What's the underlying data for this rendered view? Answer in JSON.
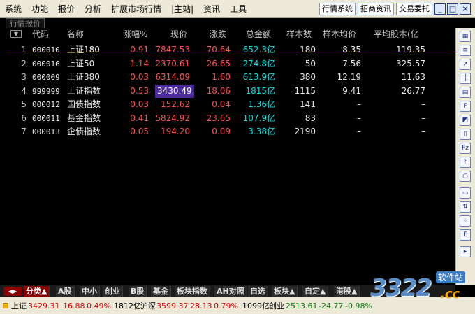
{
  "menubar": {
    "items": [
      "系统",
      "功能",
      "报价",
      "分析",
      "扩展市场行情",
      "|主站|",
      "资讯",
      "工具"
    ],
    "buttons": [
      "行情系统",
      "招商资讯",
      "交易委托"
    ],
    "window_buttons": [
      "_",
      "□",
      "×"
    ]
  },
  "tabstrip": {
    "active_tab": "行情报价"
  },
  "table": {
    "sort_glyph": "▼",
    "columns": [
      "代码",
      "名称",
      "涨幅%",
      "现价",
      "涨跌",
      "总金额",
      "样本数",
      "样本均价",
      "平均股本(亿"
    ],
    "rows": [
      {
        "idx": "1",
        "code": "000010",
        "name": "上证180",
        "pct": "0.91",
        "price": "7847.53",
        "chg": "70.64",
        "amount": "652.3亿",
        "samples": "180",
        "avg_price": "8.35",
        "avg_cap": "119.35"
      },
      {
        "idx": "2",
        "code": "000016",
        "name": "上证50",
        "pct": "1.14",
        "price": "2370.61",
        "chg": "26.65",
        "amount": "274.8亿",
        "samples": "50",
        "avg_price": "7.56",
        "avg_cap": "325.57"
      },
      {
        "idx": "3",
        "code": "000009",
        "name": "上证380",
        "pct": "0.03",
        "price": "6314.09",
        "chg": "1.60",
        "amount": "613.9亿",
        "samples": "380",
        "avg_price": "12.19",
        "avg_cap": "11.63"
      },
      {
        "idx": "4",
        "code": "999999",
        "name": "上证指数",
        "pct": "0.53",
        "price": "3430.49",
        "chg": "18.06",
        "amount": "1815亿",
        "samples": "1115",
        "avg_price": "9.41",
        "avg_cap": "26.77"
      },
      {
        "idx": "5",
        "code": "000012",
        "name": "国债指数",
        "pct": "0.03",
        "price": "152.62",
        "chg": "0.04",
        "amount": "1.36亿",
        "samples": "141",
        "avg_price": "–",
        "avg_cap": "–"
      },
      {
        "idx": "6",
        "code": "000011",
        "name": "基金指数",
        "pct": "0.41",
        "price": "5824.92",
        "chg": "23.65",
        "amount": "107.9亿",
        "samples": "83",
        "avg_price": "–",
        "avg_cap": "–"
      },
      {
        "idx": "7",
        "code": "000013",
        "name": "企债指数",
        "pct": "0.05",
        "price": "194.20",
        "chg": "0.09",
        "amount": "3.38亿",
        "samples": "2190",
        "avg_price": "–",
        "avg_cap": "–"
      }
    ],
    "selected_row": 4
  },
  "category_tabs": {
    "arrows": "◀▶",
    "items": [
      "分类▲",
      "A股",
      "中小",
      "创业",
      "B股",
      "基金",
      "板块指数",
      "AH对照",
      "自选",
      "板块▲",
      "自定▲",
      "港股▲"
    ],
    "active": "分类▲"
  },
  "status": {
    "sh_label": "上证",
    "sh_value": "3429.31",
    "sh_chg": "16.88",
    "sh_pct": "0.49%",
    "sh_amount": "1812亿",
    "hs_label": "沪深",
    "hs_value": "3599.37",
    "hs_chg": "28.13",
    "hs_pct": "0.79%",
    "hs_amount": "1099亿",
    "cy_label": "创业",
    "cy_value": "2513.61",
    "cy_chg": "-24.77",
    "cy_pct": "-0.98%"
  },
  "watermark": {
    "digits": "3322",
    "cn": "软件站",
    "domain": ".cc"
  },
  "colors": {
    "up": "#ff5050",
    "amount": "#00e0e0",
    "selected_bg": "#4b2a9c",
    "status_down": "#008000"
  }
}
